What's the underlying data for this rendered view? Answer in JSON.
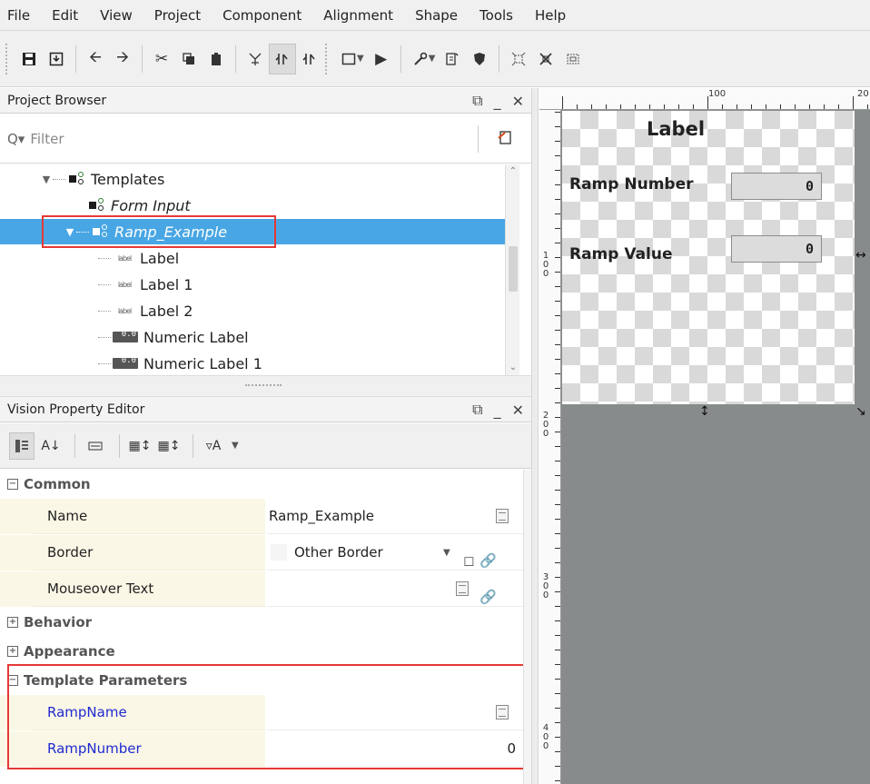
{
  "menu": [
    "File",
    "Edit",
    "View",
    "Project",
    "Component",
    "Alignment",
    "Shape",
    "Tools",
    "Help"
  ],
  "toolbar": {
    "icons": [
      "save-icon",
      "save-all-icon",
      "undo-icon",
      "redo-icon",
      "cut-icon",
      "copy-icon",
      "paste-icon",
      "snap-icon",
      "layout-mode-icon",
      "move-icon",
      "window-icon",
      "play-icon",
      "wrench-icon",
      "publish-icon",
      "security-icon",
      "alignment-icon",
      "group-icon",
      "ungroup-icon"
    ]
  },
  "project_browser": {
    "title": "Project Browser",
    "filter_placeholder": "Filter",
    "tree": [
      {
        "label": "Templates",
        "level": 1,
        "kind": "folder"
      },
      {
        "label": "Form Input",
        "level": 2,
        "kind": "template"
      },
      {
        "label": "Ramp_Example",
        "level": 2,
        "kind": "template",
        "selected": true
      },
      {
        "label": "Label",
        "level": 3,
        "kind": "label"
      },
      {
        "label": "Label 1",
        "level": 3,
        "kind": "label"
      },
      {
        "label": "Label 2",
        "level": 3,
        "kind": "label"
      },
      {
        "label": "Numeric Label",
        "level": 3,
        "kind": "numeric"
      },
      {
        "label": "Numeric Label 1",
        "level": 3,
        "kind": "numeric"
      }
    ]
  },
  "property_editor": {
    "title": "Vision Property Editor",
    "categories": {
      "common": "Common",
      "behavior": "Behavior",
      "appearance": "Appearance",
      "template_parameters": "Template Parameters"
    },
    "common": {
      "name_label": "Name",
      "name_value": "Ramp_Example",
      "border_label": "Border",
      "border_value": "Other Border",
      "mouseover_label": "Mouseover Text",
      "mouseover_value": ""
    },
    "params": {
      "ramp_name_label": "RampName",
      "ramp_name_value": "",
      "ramp_number_label": "RampNumber",
      "ramp_number_value": "0"
    }
  },
  "designer": {
    "title_label": "Label",
    "ramp_number_label": "Ramp Number",
    "ramp_number_value": "0",
    "ramp_value_label": "Ramp Value",
    "ramp_value_value": "0",
    "ruler_top": [
      "100",
      "20"
    ],
    "ruler_left": [
      "1 0 0",
      "2 0 0",
      "3 0 0",
      "4 0 0"
    ]
  },
  "colors": {
    "selection": "#49a6e4",
    "highlight": "#e53935",
    "param_text": "#1f2ad1",
    "designer_bg": "#878b8c"
  }
}
